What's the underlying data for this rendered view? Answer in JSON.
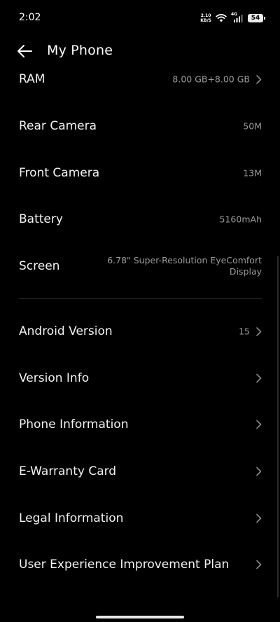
{
  "status_bar": {
    "time": "2:02",
    "net_speed_value": "2.10",
    "net_speed_unit": "KB/S",
    "network_type": "4G",
    "battery_level": "54"
  },
  "header": {
    "title": "My Phone",
    "back_icon": "arrow-left-icon"
  },
  "specs": [
    {
      "label": "RAM",
      "value": "8.00 GB+8.00 GB",
      "has_chevron": true
    },
    {
      "label": "Rear Camera",
      "value": "50M",
      "has_chevron": false
    },
    {
      "label": "Front Camera",
      "value": "13M",
      "has_chevron": false
    },
    {
      "label": "Battery",
      "value": "5160mAh",
      "has_chevron": false
    },
    {
      "label": "Screen",
      "value": "6.78\" Super-Resolution EyeComfort Display",
      "has_chevron": false
    }
  ],
  "info_items": [
    {
      "label": "Android Version",
      "value": "15",
      "has_chevron": true
    },
    {
      "label": "Version Info",
      "value": "",
      "has_chevron": true
    },
    {
      "label": "Phone Information",
      "value": "",
      "has_chevron": true
    },
    {
      "label": "E-Warranty Card",
      "value": "",
      "has_chevron": true
    },
    {
      "label": "Legal Information",
      "value": "",
      "has_chevron": true
    },
    {
      "label": "User Experience Improvement Plan",
      "value": "",
      "has_chevron": true
    }
  ],
  "colors": {
    "background": "#000000",
    "text_primary": "#f2f2f2",
    "text_secondary": "#9a9a9a"
  }
}
